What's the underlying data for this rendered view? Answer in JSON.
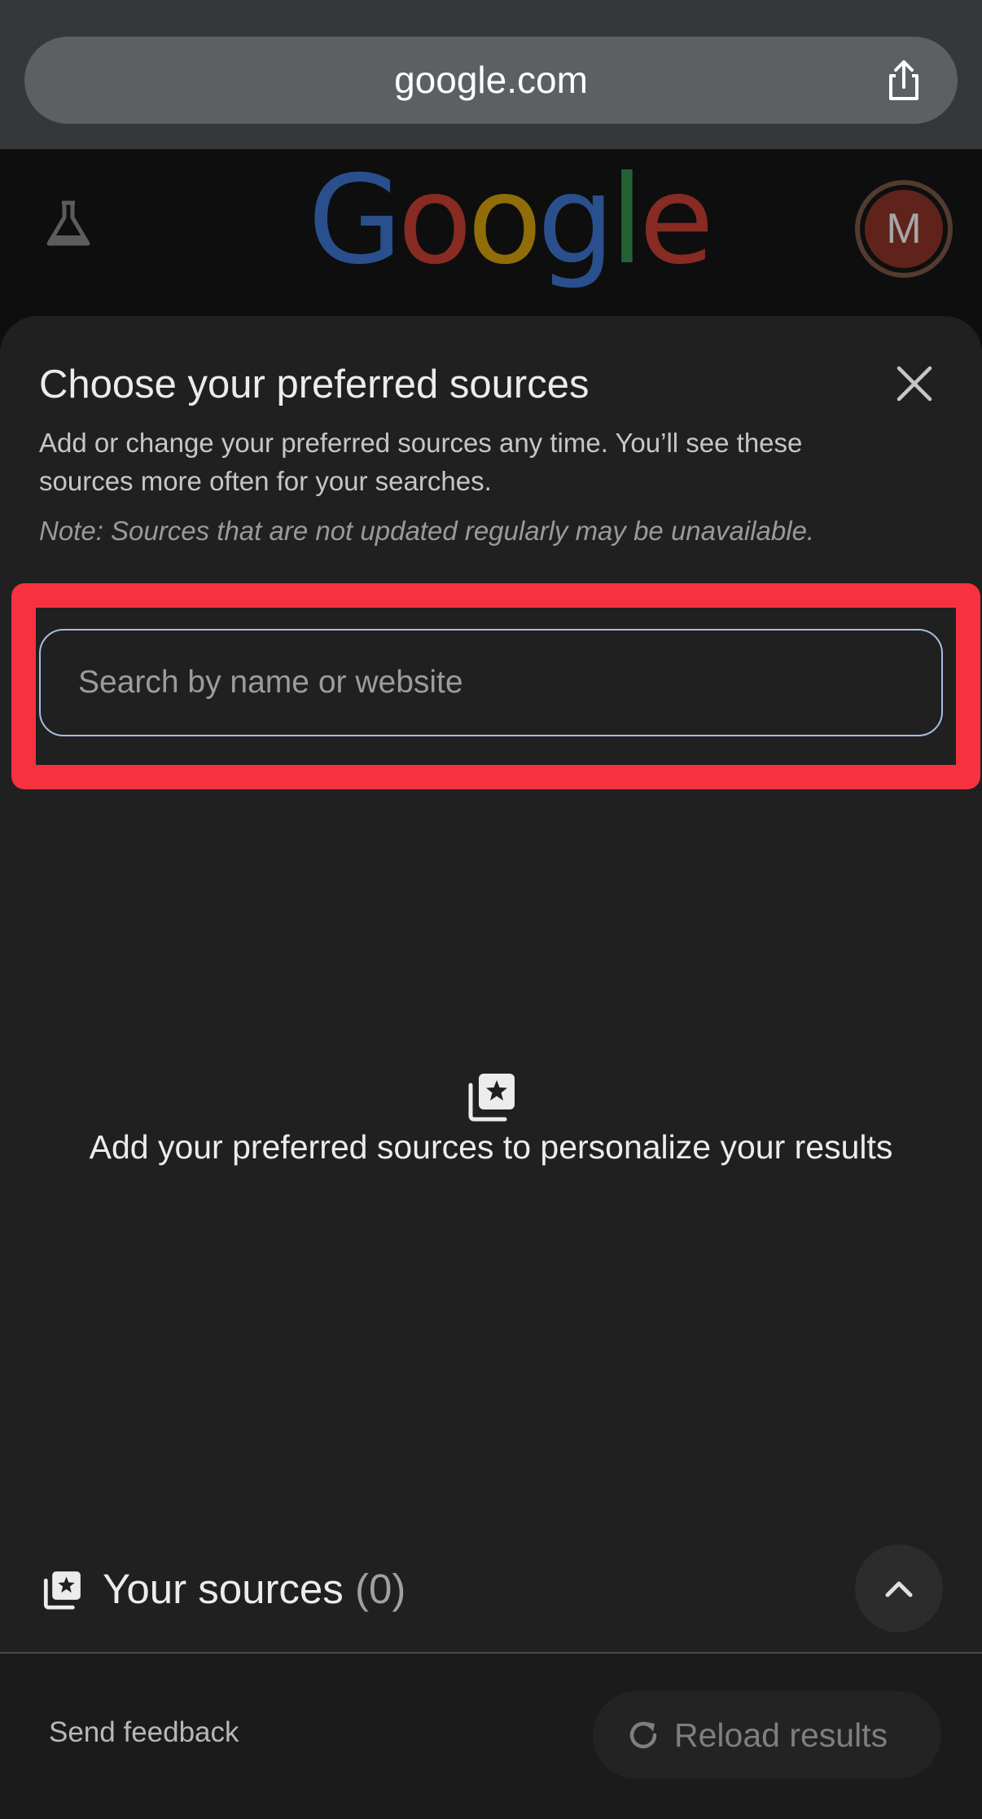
{
  "browser": {
    "url": "google.com",
    "share_icon": "share-icon"
  },
  "header": {
    "labs_icon": "labs-flask-icon",
    "logo_letters": [
      "G",
      "o",
      "o",
      "g",
      "l",
      "e"
    ],
    "avatar_initial": "M"
  },
  "modal": {
    "title": "Choose your preferred sources",
    "description": "Add or change your preferred sources any time. You’ll see these sources more often for your searches.",
    "note": "Note: Sources that are not updated regularly may be unavailable.",
    "search": {
      "placeholder": "Search by name or website",
      "value": ""
    },
    "empty_state": {
      "icon": "star-cards-icon",
      "text": "Add your preferred sources to personalize your results"
    },
    "your_sources": {
      "label": "Your sources",
      "count": "(0)"
    },
    "footer": {
      "feedback_label": "Send feedback",
      "reload_label": "Reload results"
    }
  },
  "colors": {
    "sheet_bg": "#202021",
    "highlight": "#f6323f",
    "input_border": "#a9bce0"
  }
}
